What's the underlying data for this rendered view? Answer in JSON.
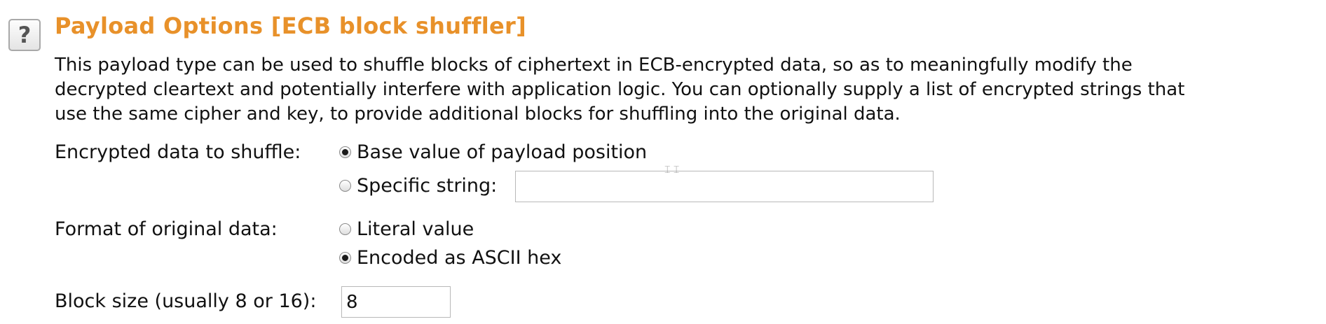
{
  "help_button": {
    "label": "?"
  },
  "panel": {
    "title": "Payload Options [ECB block shuffler]",
    "description_lines": [
      "This payload type can be used to shuffle blocks of ciphertext in ECB-encrypted data, so as to meaningfully modify the",
      "decrypted cleartext and potentially interfere with application logic. You can optionally supply a list of encrypted strings that",
      "use the same cipher and key, to provide additional blocks for shuffling into the original data."
    ]
  },
  "encrypted_data": {
    "label": "Encrypted data to shuffle:",
    "options": [
      {
        "label": "Base value of payload position",
        "checked": true
      },
      {
        "label": "Specific string:",
        "checked": false
      }
    ],
    "specific_string_value": ""
  },
  "format": {
    "label": "Format of original data:",
    "options": [
      {
        "label": "Literal value",
        "checked": false
      },
      {
        "label": "Encoded as ASCII hex",
        "checked": true
      }
    ]
  },
  "block_size": {
    "label": "Block size (usually 8 or 16):",
    "value": "8"
  }
}
